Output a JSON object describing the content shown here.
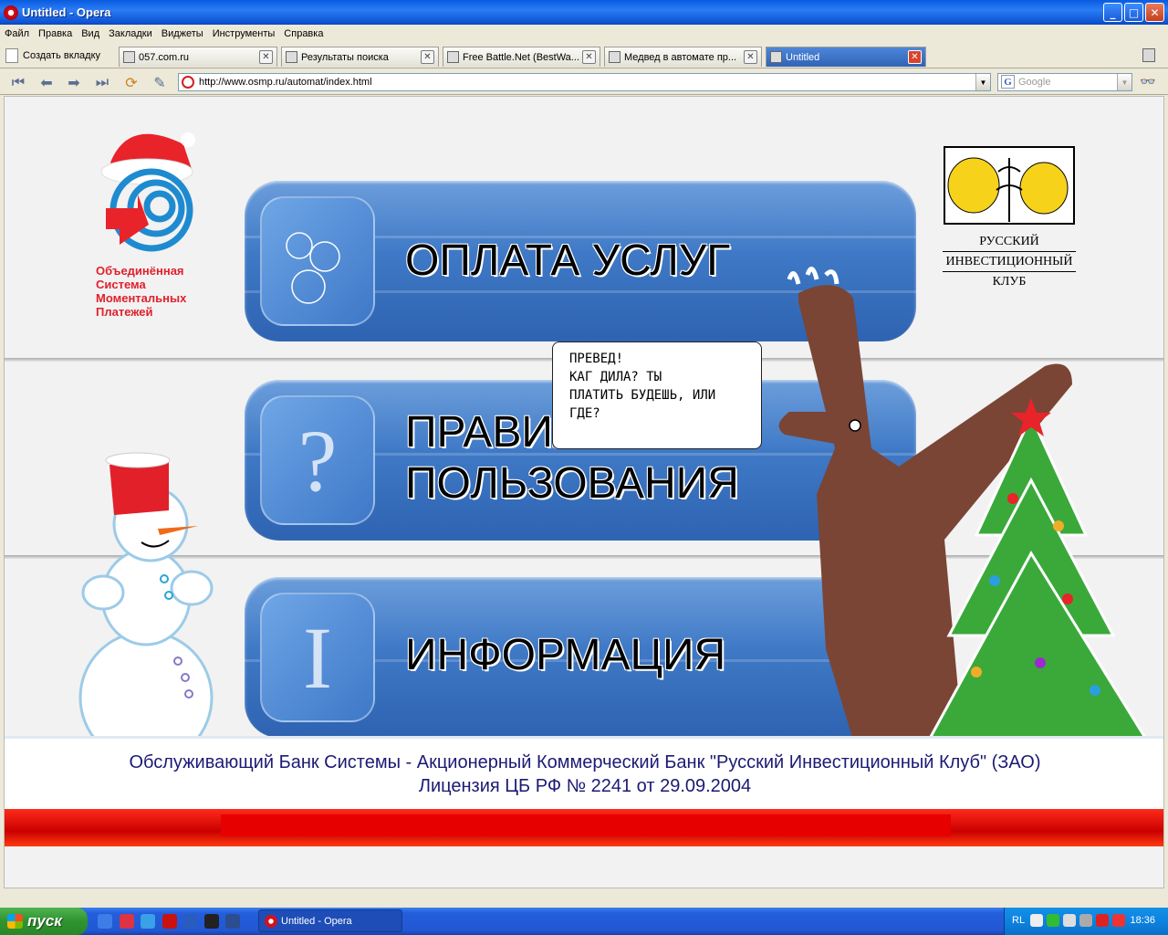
{
  "window": {
    "title": "Untitled - Opera",
    "controls": [
      "minimize",
      "maximize",
      "close"
    ]
  },
  "menu": [
    "Файл",
    "Правка",
    "Вид",
    "Закладки",
    "Виджеты",
    "Инструменты",
    "Справка"
  ],
  "tabs": {
    "new_tab_label": "Создать вкладку",
    "items": [
      {
        "label": "057.com.ru",
        "active": false
      },
      {
        "label": "Результаты поиска",
        "active": false
      },
      {
        "label": "Free Battle.Net (BestWa...",
        "active": false
      },
      {
        "label": "Медвед в автомате пр...",
        "active": false
      },
      {
        "label": "Untitled",
        "active": true
      }
    ]
  },
  "addressbar": {
    "url": "http://www.osmp.ru/automat/index.html",
    "search_placeholder": "Google"
  },
  "page": {
    "osmp_logo_text": [
      "Объединённая",
      "Система",
      "Моментальных",
      "Платежей"
    ],
    "rik_logo_text": [
      "РУССКИЙ",
      "ИНВЕСТИЦИОННЫЙ",
      "КЛУБ"
    ],
    "buttons": [
      {
        "label": "ОПЛАТА УСЛУГ",
        "icon": "bubbles-icon"
      },
      {
        "label_line1": "ПРАВИЛА",
        "label_line2": "ПОЛЬЗОВАНИЯ",
        "icon_glyph": "?"
      },
      {
        "label": "ИНФОРМАЦИЯ",
        "icon_glyph": "I"
      }
    ],
    "speech_bubble": [
      "ПРЕВЕД!",
      "КАГ ДИЛА? ТЫ",
      "ПЛАТИТЬ БУДЕШЬ, ИЛИ",
      "ГДЕ?"
    ],
    "footer_line1": "Обслуживающий Банк Системы  - Акционерный Коммерческий Банк \"Русский Инвестиционный Клуб\" (ЗАО)",
    "footer_line2": "Лицензия ЦБ РФ № 2241 от 29.09.2004"
  },
  "taskbar": {
    "start_label": "пуск",
    "task": "Untitled - Opera",
    "lang": "RL",
    "clock": "18:36"
  },
  "colors": {
    "accent_blue": "#3f79c6",
    "osmp_red": "#e0212d",
    "footer_text": "#1b1a74",
    "bear_brown": "#7a4535"
  }
}
